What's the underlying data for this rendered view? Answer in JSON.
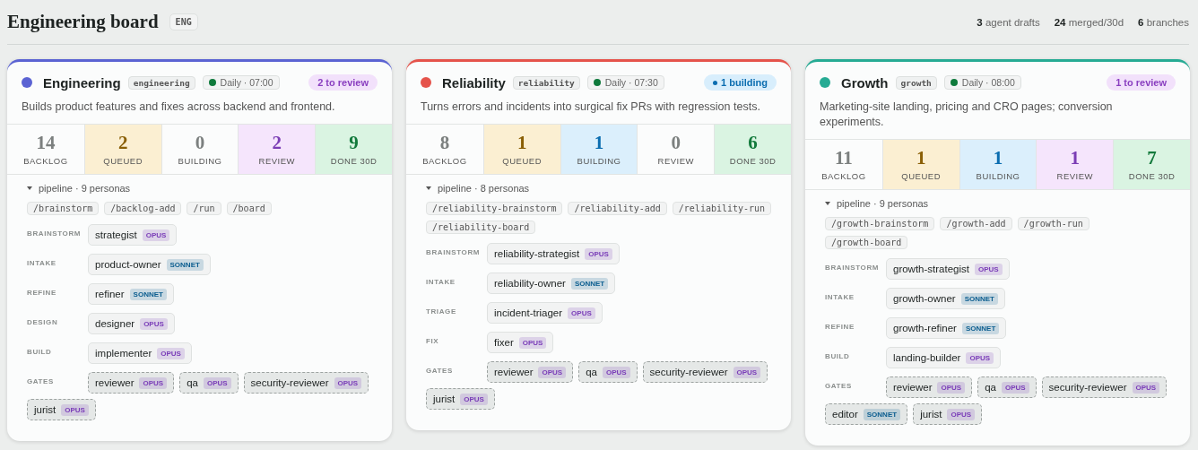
{
  "header": {
    "title": "Engineering board",
    "tag": "ENG",
    "stats": [
      "**3** agent drafts",
      "**24** merged/30d",
      "**6** branches"
    ]
  },
  "boards": [
    {
      "name": "Engineering",
      "color": "#5b63d3",
      "slug": "engineering",
      "schedule": {
        "text": "Daily · 07:00",
        "active": true
      },
      "badge": {
        "kind": "review",
        "text": "2 to review"
      },
      "description": "Builds product features and fixes across backend and frontend.",
      "counts": [
        {
          "kind": "backlog",
          "value": "14",
          "label": "BACKLOG",
          "highlighted": false
        },
        {
          "kind": "queued",
          "value": "2",
          "label": "QUEUED",
          "highlighted": true
        },
        {
          "kind": "building",
          "value": "0",
          "label": "BUILDING",
          "highlighted": false
        },
        {
          "kind": "review",
          "value": "2",
          "label": "REVIEW",
          "highlighted": true
        },
        {
          "kind": "done",
          "value": "9",
          "label": "DONE 30D",
          "highlighted": true
        }
      ],
      "pipeline": {
        "summary": "pipeline · 9 personas",
        "expanded": true
      },
      "commands": [
        "/brainstorm",
        "/backlog-add",
        "/run",
        "/board"
      ],
      "stages": [
        {
          "label": "BRAINSTORM",
          "kind": "step",
          "personas": [
            {
              "name": "strategist",
              "model": "OPUS",
              "color": "#7a3db8"
            }
          ]
        },
        {
          "label": "INTAKE",
          "kind": "step",
          "personas": [
            {
              "name": "product-owner",
              "model": "SONNET",
              "color": "#0b5d8f"
            }
          ]
        },
        {
          "label": "REFINE",
          "kind": "step",
          "personas": [
            {
              "name": "refiner",
              "model": "SONNET",
              "color": "#0b5d8f"
            }
          ]
        },
        {
          "label": "DESIGN",
          "kind": "step",
          "personas": [
            {
              "name": "designer",
              "model": "OPUS",
              "color": "#7a3db8"
            }
          ]
        },
        {
          "label": "BUILD",
          "kind": "step",
          "personas": [
            {
              "name": "implementer",
              "model": "OPUS",
              "color": "#7a3db8"
            }
          ]
        },
        {
          "label": "GATES",
          "kind": "gate",
          "personas": [
            {
              "name": "reviewer",
              "model": "OPUS",
              "color": "#7a3db8"
            },
            {
              "name": "qa",
              "model": "OPUS",
              "color": "#7a3db8"
            },
            {
              "name": "security-reviewer",
              "model": "OPUS",
              "color": "#7a3db8"
            },
            {
              "name": "jurist",
              "model": "OPUS",
              "color": "#7a3db8"
            }
          ]
        }
      ]
    },
    {
      "name": "Reliability",
      "color": "#e5534b",
      "slug": "reliability",
      "schedule": {
        "text": "Daily · 07:30",
        "active": true
      },
      "badge": {
        "kind": "building",
        "text": "1 building"
      },
      "description": "Turns errors and incidents into surgical fix PRs with regression tests.",
      "counts": [
        {
          "kind": "backlog",
          "value": "8",
          "label": "BACKLOG",
          "highlighted": false
        },
        {
          "kind": "queued",
          "value": "1",
          "label": "QUEUED",
          "highlighted": true
        },
        {
          "kind": "building",
          "value": "1",
          "label": "BUILDING",
          "highlighted": true
        },
        {
          "kind": "review",
          "value": "0",
          "label": "REVIEW",
          "highlighted": false
        },
        {
          "kind": "done",
          "value": "6",
          "label": "DONE 30D",
          "highlighted": true
        }
      ],
      "pipeline": {
        "summary": "pipeline · 8 personas",
        "expanded": true
      },
      "commands": [
        "/reliability-brainstorm",
        "/reliability-add",
        "/reliability-run",
        "/reliability-board"
      ],
      "stages": [
        {
          "label": "BRAINSTORM",
          "kind": "step",
          "personas": [
            {
              "name": "reliability-strategist",
              "model": "OPUS",
              "color": "#7a3db8"
            }
          ]
        },
        {
          "label": "INTAKE",
          "kind": "step",
          "personas": [
            {
              "name": "reliability-owner",
              "model": "SONNET",
              "color": "#0b5d8f"
            }
          ]
        },
        {
          "label": "TRIAGE",
          "kind": "step",
          "personas": [
            {
              "name": "incident-triager",
              "model": "OPUS",
              "color": "#7a3db8"
            }
          ]
        },
        {
          "label": "FIX",
          "kind": "step",
          "personas": [
            {
              "name": "fixer",
              "model": "OPUS",
              "color": "#7a3db8"
            }
          ]
        },
        {
          "label": "GATES",
          "kind": "gate",
          "personas": [
            {
              "name": "reviewer",
              "model": "OPUS",
              "color": "#7a3db8"
            },
            {
              "name": "qa",
              "model": "OPUS",
              "color": "#7a3db8"
            },
            {
              "name": "security-reviewer",
              "model": "OPUS",
              "color": "#7a3db8"
            },
            {
              "name": "jurist",
              "model": "OPUS",
              "color": "#7a3db8"
            }
          ]
        }
      ]
    },
    {
      "name": "Growth",
      "color": "#26ab94",
      "slug": "growth",
      "schedule": {
        "text": "Daily · 08:00",
        "active": true
      },
      "badge": {
        "kind": "review",
        "text": "1 to review"
      },
      "description": "Marketing-site landing, pricing and CRO pages; conversion experiments.",
      "counts": [
        {
          "kind": "backlog",
          "value": "11",
          "label": "BACKLOG",
          "highlighted": false
        },
        {
          "kind": "queued",
          "value": "1",
          "label": "QUEUED",
          "highlighted": true
        },
        {
          "kind": "building",
          "value": "1",
          "label": "BUILDING",
          "highlighted": true
        },
        {
          "kind": "review",
          "value": "1",
          "label": "REVIEW",
          "highlighted": true
        },
        {
          "kind": "done",
          "value": "7",
          "label": "DONE 30D",
          "highlighted": true
        }
      ],
      "pipeline": {
        "summary": "pipeline · 9 personas",
        "expanded": true
      },
      "commands": [
        "/growth-brainstorm",
        "/growth-add",
        "/growth-run",
        "/growth-board"
      ],
      "stages": [
        {
          "label": "BRAINSTORM",
          "kind": "step",
          "personas": [
            {
              "name": "growth-strategist",
              "model": "OPUS",
              "color": "#7a3db8"
            }
          ]
        },
        {
          "label": "INTAKE",
          "kind": "step",
          "personas": [
            {
              "name": "growth-owner",
              "model": "SONNET",
              "color": "#0b5d8f"
            }
          ]
        },
        {
          "label": "REFINE",
          "kind": "step",
          "personas": [
            {
              "name": "growth-refiner",
              "model": "SONNET",
              "color": "#0b5d8f"
            }
          ]
        },
        {
          "label": "BUILD",
          "kind": "step",
          "personas": [
            {
              "name": "landing-builder",
              "model": "OPUS",
              "color": "#7a3db8"
            }
          ]
        },
        {
          "label": "GATES",
          "kind": "gate",
          "personas": [
            {
              "name": "reviewer",
              "model": "OPUS",
              "color": "#7a3db8"
            },
            {
              "name": "qa",
              "model": "OPUS",
              "color": "#7a3db8"
            },
            {
              "name": "security-reviewer",
              "model": "OPUS",
              "color": "#7a3db8"
            },
            {
              "name": "editor",
              "model": "SONNET",
              "color": "#0b5d8f"
            },
            {
              "name": "jurist",
              "model": "OPUS",
              "color": "#7a3db8"
            }
          ]
        }
      ]
    }
  ]
}
